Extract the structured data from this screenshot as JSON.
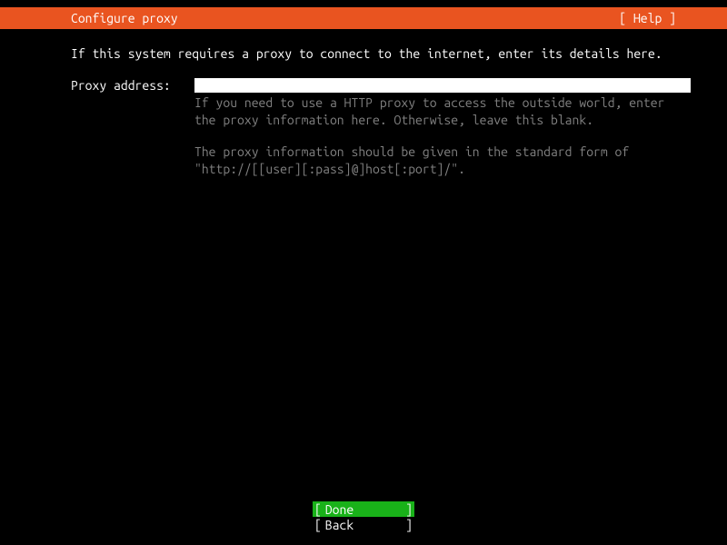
{
  "header": {
    "title": "Configure proxy",
    "help": "[ Help ]"
  },
  "instruction": "If this system requires a proxy to connect to the internet, enter its details here.",
  "form": {
    "label": "Proxy address:",
    "value": "",
    "help1": "If you need to use a HTTP proxy to access the outside world, enter the proxy information here. Otherwise, leave this blank.",
    "help2": "The proxy information should be given in the standard form of \"http://[[user][:pass]@]host[:port]/\"."
  },
  "buttons": {
    "done": "Done",
    "back": "Back"
  }
}
